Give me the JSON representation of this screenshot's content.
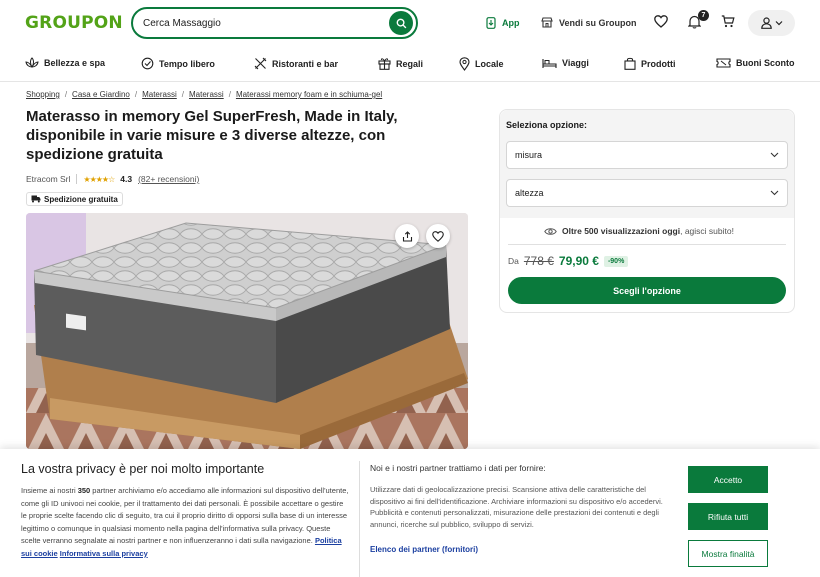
{
  "header": {
    "logo": "GROUPON",
    "search_value": "Cerca Massaggio",
    "app_label": "App",
    "sell_label": "Vendi su Groupon",
    "notification_count": "7"
  },
  "nav": [
    "Bellezza e spa",
    "Tempo libero",
    "Ristoranti e bar",
    "Regali",
    "Locale",
    "Viaggi",
    "Prodotti",
    "Buoni Sconto"
  ],
  "breadcrumb": [
    "Shopping",
    "Casa e Giardino",
    "Materassi",
    "Materassi",
    "Materassi memory foam e in schiuma-gel"
  ],
  "product": {
    "title": "Materasso in memory Gel SuperFresh, Made in Italy, disponibile in varie misure e 3 diverse altezze, con spedizione gratuita",
    "seller": "Etracom Srl",
    "stars": "★★★★☆",
    "rating": "4.3",
    "reviews": "(82+ recensioni)",
    "shipping": "Spedizione gratuita"
  },
  "options": {
    "label": "Seleziona opzione:",
    "select1": "misura",
    "select2": "altezza",
    "views_bold": "Oltre 500 visualizzazioni oggi",
    "views_rest": ", agisci subito!",
    "from_label": "Da",
    "old_price": "778 €",
    "new_price": "79,90 €",
    "discount": "-90%",
    "cta": "Scegli l'opzione"
  },
  "cookie": {
    "title": "La vostra privacy è per noi molto importante",
    "text_a": "Insieme ai nostri ",
    "text_partners": "350",
    "text_b": " partner archiviamo e/o accediamo alle informazioni sul dispositivo dell'utente, come gli ID univoci nei cookie, per il trattamento dei dati personali. È possibile accettare o gestire le proprie scelte facendo clic di seguito, tra cui il proprio diritto di opporsi sulla base di un interesse legittimo o comunque in qualsiasi momento nella pagina dell'informativa sulla privacy. Queste scelte verranno segnalate ai nostri partner e non influenzeranno i dati sulla navigazione. ",
    "link_cookie": "Politica sui cookie",
    "link_privacy": "Informativa sulla privacy",
    "heading2": "Noi e i nostri partner trattiamo i dati per fornire:",
    "text2": "Utilizzare dati di geolocalizzazione precisi. Scansione attiva delle caratteristiche del dispositivo ai fini dell'identificazione. Archiviare informazioni su dispositivo e/o accedervi. Pubblicità e contenuti personalizzati, misurazione delle prestazioni dei contenuti e degli annunci, ricerche sul pubblico, sviluppo di servizi.",
    "partners_link": "Elenco dei partner (fornitori)",
    "accept": "Accetto",
    "reject": "Rifiuta tutti",
    "purposes": "Mostra finalità"
  },
  "colors": {
    "brand_green": "#53a318",
    "accent": "#0a7a3c",
    "link_blue": "#1b3fa0"
  }
}
